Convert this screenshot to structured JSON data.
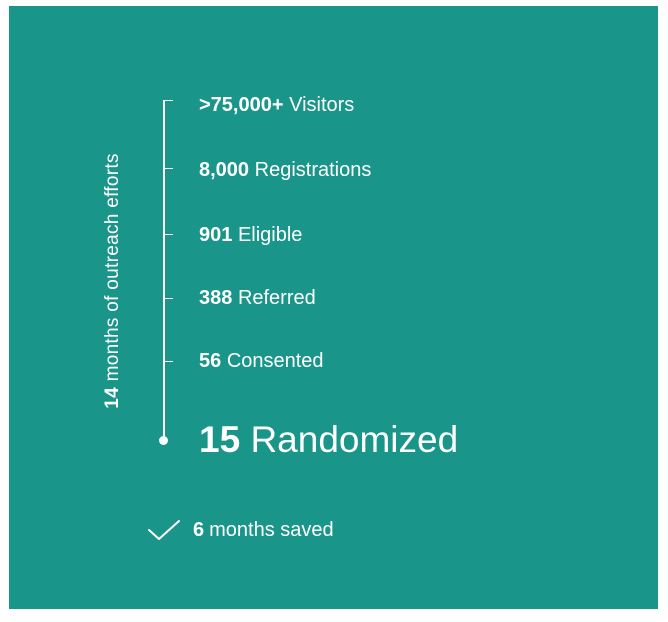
{
  "side_label": {
    "number": "14",
    "text": "months of outreach efforts"
  },
  "steps": [
    {
      "number": ">75,000+",
      "label": "Visitors"
    },
    {
      "number": "8,000",
      "label": "Registrations"
    },
    {
      "number": "901",
      "label": "Eligible"
    },
    {
      "number": "388",
      "label": "Referred"
    },
    {
      "number": "56",
      "label": "Consented"
    },
    {
      "number": "15",
      "label": "Randomized"
    }
  ],
  "saved": {
    "icon": "checkmark-icon",
    "number": "6",
    "text": "months saved"
  },
  "colors": {
    "background": "#1a958a",
    "text": "#ffffff"
  }
}
